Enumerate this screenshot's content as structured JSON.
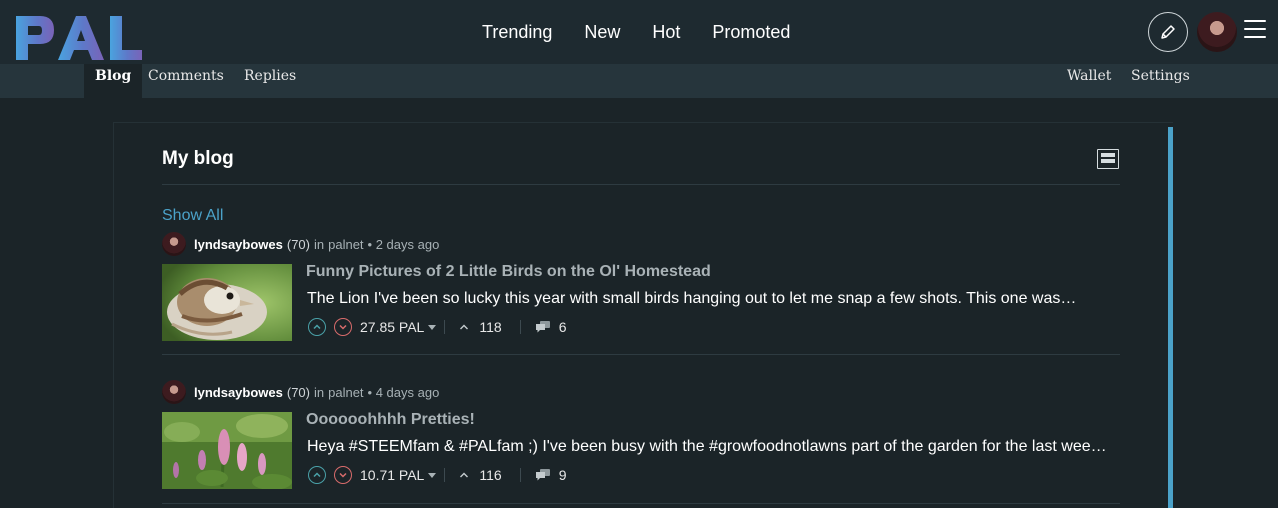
{
  "brand": {
    "logo_text": "PAL"
  },
  "nav": {
    "items": [
      "Trending",
      "New",
      "Hot",
      "Promoted"
    ]
  },
  "header": {
    "compose_icon": "pencil-icon",
    "avatar_icon": "user-avatar",
    "menu_icon": "hamburger-icon"
  },
  "subnav": {
    "left": [
      "Blog",
      "Comments",
      "Replies"
    ],
    "right": [
      "Wallet",
      "Settings"
    ],
    "active": "Blog"
  },
  "blog": {
    "title": "My blog",
    "show_all": "Show All",
    "layout_icon": "list-layout-icon"
  },
  "posts": [
    {
      "author": "lyndsaybowes",
      "reputation": "(70)",
      "community_prefix": "in",
      "community": "palnet",
      "time": "• 2 days ago",
      "title": "Funny Pictures of 2 Little Birds on the Ol' Homestead",
      "excerpt": "The Lion I've been so lucky this year with small birds hanging out to let me snap a few shots. This one was…",
      "payout": "27.85 PAL",
      "votes": "118",
      "replies": "6",
      "thumbnail": "sparrow-photo"
    },
    {
      "author": "lyndsaybowes",
      "reputation": "(70)",
      "community_prefix": "in",
      "community": "palnet",
      "time": "• 4 days ago",
      "title": "Oooooohhhh Pretties!",
      "excerpt": "Heya #STEEMfam & #PALfam ;) I've been busy with the #growfoodnotlawns part of the garden for the last wee…",
      "payout": "10.71 PAL",
      "votes": "116",
      "replies": "9",
      "thumbnail": "lupine-flowers-photo"
    }
  ],
  "colors": {
    "background": "#1b2428",
    "header": "#1e2a30",
    "subnav": "#26353c",
    "accent": "#4ba2c9",
    "upvote": "#4aa1a8",
    "downvote": "#d86b6b"
  }
}
